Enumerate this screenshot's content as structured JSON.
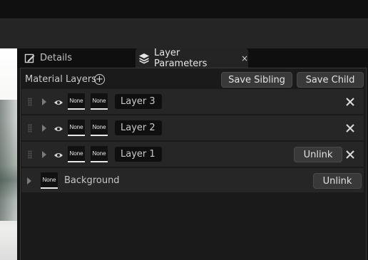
{
  "tabs": {
    "details": "Details",
    "layer_parameters": "Layer Parameters",
    "close_glyph": "×"
  },
  "panel": {
    "title": "Material Layers",
    "add_glyph": "+",
    "save_sibling": "Save Sibling",
    "save_child": "Save Child"
  },
  "layers": [
    {
      "name": "Layer 3",
      "thumb1": "None",
      "thumb2": "None",
      "unlink": ""
    },
    {
      "name": "Layer 2",
      "thumb1": "None",
      "thumb2": "None",
      "unlink": ""
    },
    {
      "name": "Layer 1",
      "thumb1": "None",
      "thumb2": "None",
      "unlink": "Unlink"
    }
  ],
  "background": {
    "thumb": "None",
    "label": "Background",
    "unlink": "Unlink"
  }
}
